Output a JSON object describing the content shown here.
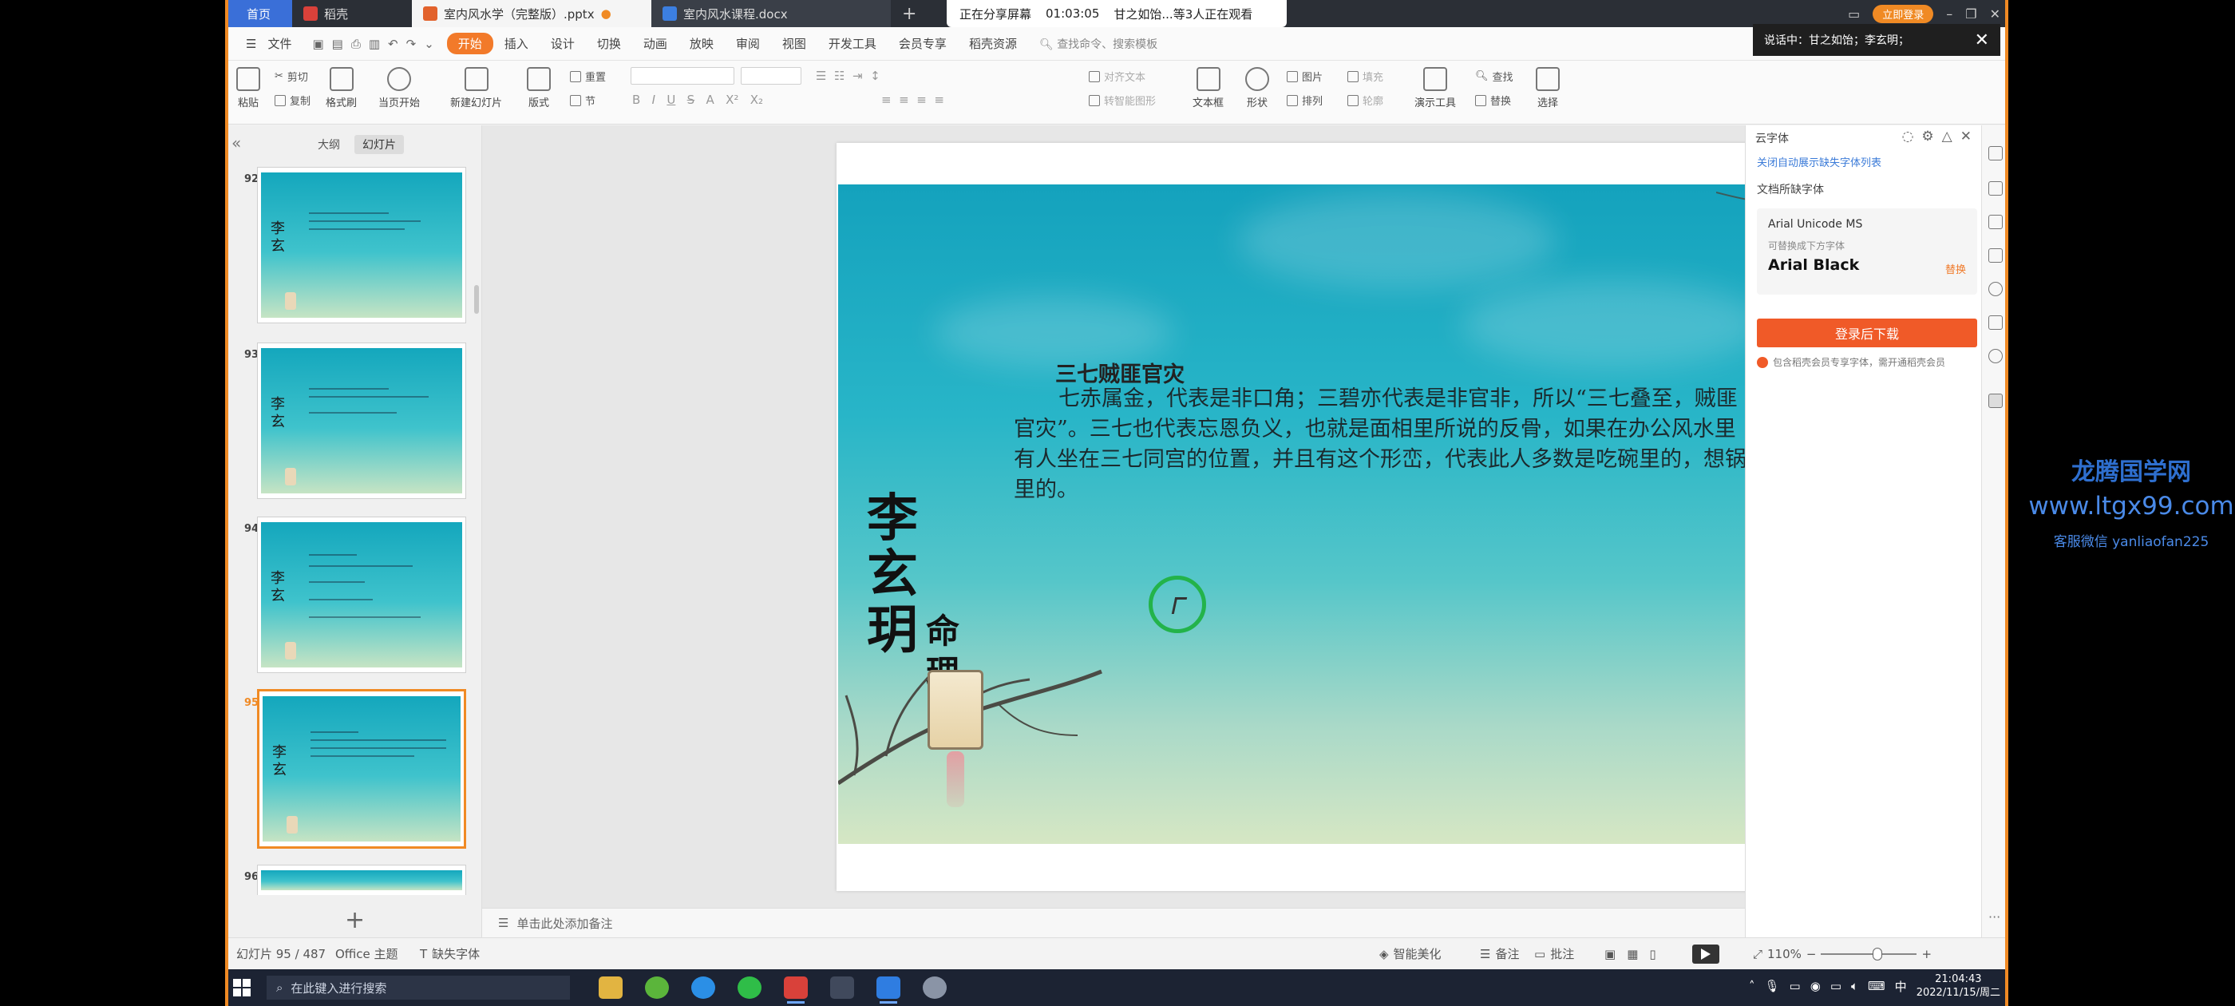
{
  "titlebar": {
    "tabs": [
      {
        "label": "首页",
        "kind": "home"
      },
      {
        "label": "稻壳",
        "kind": "daoke"
      },
      {
        "label": "室内风水学（完整版）.pptx",
        "kind": "pptx",
        "active": true
      },
      {
        "label": "室内风水课程.docx",
        "kind": "docx"
      }
    ],
    "share_status": "正在分享屏幕",
    "share_time": "01:03:05",
    "share_viewers": "甘之如饴...等3人正在观看",
    "user_label": "立即登录"
  },
  "caption_popup": {
    "text": "说话中：甘之如饴；李玄明；"
  },
  "menu": {
    "file": "文件",
    "items": [
      "开始",
      "插入",
      "设计",
      "切换",
      "动画",
      "放映",
      "审阅",
      "视图",
      "开发工具",
      "会员专享",
      "稻壳资源"
    ],
    "active_index": 0,
    "search_placeholder": "查找命令、搜索模板"
  },
  "ribbon": {
    "paste": "粘贴",
    "cut": "剪切",
    "copy": "复制",
    "format_painter": "格式刷",
    "from_current": "当页开始",
    "new_slide": "新建幻灯片",
    "layout": "版式",
    "section": "节",
    "reset": "重置",
    "convert_shape": "转智能图形",
    "text_box": "文本框",
    "shape": "形状",
    "picture": "图片",
    "arrange": "排列",
    "fill": "填充",
    "outline": "轮廓",
    "presentation_tools": "演示工具",
    "find": "查找",
    "replace": "替换",
    "select": "选择",
    "align_text": "对齐文本"
  },
  "left_panel": {
    "tab_outline": "大纲",
    "tab_slides": "幻灯片",
    "thumbnails": [
      {
        "number": "92",
        "active": false
      },
      {
        "number": "93",
        "active": false
      },
      {
        "number": "94",
        "active": false
      },
      {
        "number": "95",
        "active": true
      },
      {
        "number": "96",
        "active": false
      }
    ]
  },
  "slide": {
    "title": "三七贼匪官灾",
    "body": "七赤属金，代表是非口角；三碧亦代表是非官非，所以“三七叠至，贼匪官灾”。三七也代表忘恩负义，也就是面相里所说的反骨，如果在办公风水里有人坐在三七同宫的位置，并且有这个形峦，代表此人多数是吃碗里的，想锅里的。",
    "calligraphy_main": "李玄玥",
    "calligraphy_sub": "命理"
  },
  "notes": {
    "placeholder": "单击此处添加备注"
  },
  "right_panel": {
    "title": "云字体",
    "link": "关闭自动展示缺失字体列表",
    "section": "文档所缺字体",
    "missing_font": "Arial Unicode MS",
    "hint": "可替换成下方字体",
    "suggested_font": "Arial Black",
    "replace_label": "替换",
    "download_button": "登录后下载",
    "note": "包含稻壳会员专享字体，需开通稻壳会员"
  },
  "statusbar": {
    "slide_counter": "幻灯片 95 / 487",
    "theme": "Office 主题",
    "missing_fonts": "缺失字体",
    "smart_beautify": "智能美化",
    "notes": "备注",
    "comments": "批注",
    "zoom": "110%",
    "zoom_fraction": 0.6
  },
  "taskbar": {
    "search_placeholder": "在此键入进行搜索",
    "input_method": "中",
    "time": "21:04:43",
    "date": "2022/11/15/周二"
  },
  "watermark": {
    "line1": "龙腾国学网",
    "line2": "www.ltgx99.com",
    "line3": "客服微信 yanliaofan225"
  },
  "colors": {
    "accent": "#f08a24",
    "download_button": "#f05a28",
    "slide_top": "#14a2bd",
    "slide_bottom": "#d6e7c4",
    "cursor_ring": "#23b34a",
    "watermark": "#2e6fcf"
  }
}
